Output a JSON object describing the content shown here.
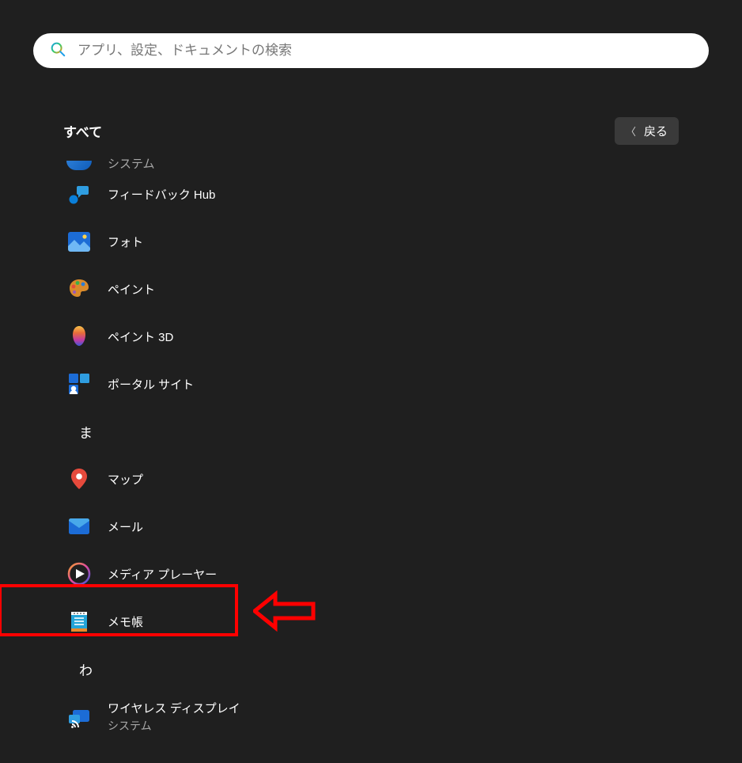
{
  "search": {
    "placeholder": "アプリ、設定、ドキュメントの検索"
  },
  "header": {
    "title": "すべて",
    "back_label": "戻る"
  },
  "cutoff": {
    "sublabel": "システム"
  },
  "apps": {
    "feedback_hub": {
      "label": "フィードバック Hub"
    },
    "photos": {
      "label": "フォト"
    },
    "paint": {
      "label": "ペイント"
    },
    "paint3d": {
      "label": "ペイント 3D"
    },
    "portal_site": {
      "label": "ポータル サイト"
    },
    "maps": {
      "label": "マップ"
    },
    "mail": {
      "label": "メール"
    },
    "media_player": {
      "label": "メディア プレーヤー"
    },
    "notepad": {
      "label": "メモ帳"
    },
    "wireless_display": {
      "label": "ワイヤレス ディスプレイ",
      "sublabel": "システム"
    }
  },
  "sections": {
    "ma": "ま",
    "wa": "わ"
  },
  "colors": {
    "highlight": "#ff0000",
    "background": "#1f1f1f"
  }
}
